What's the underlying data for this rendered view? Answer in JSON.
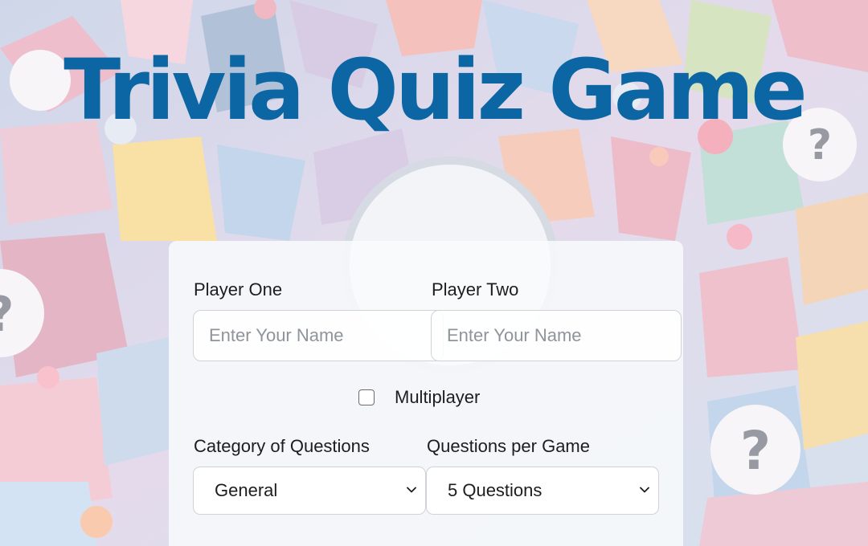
{
  "page": {
    "title": "Trivia Quiz Game"
  },
  "form": {
    "player_one": {
      "label": "Player One",
      "placeholder": "Enter Your Name",
      "value": ""
    },
    "player_two": {
      "label": "Player Two",
      "placeholder": "Enter Your Name",
      "value": ""
    },
    "multiplayer": {
      "label": "Multiplayer",
      "checked": false
    },
    "category": {
      "label": "Category of Questions",
      "selected": "General"
    },
    "questions_per_game": {
      "label": "Questions per Game",
      "selected": "5 Questions"
    }
  },
  "icons": {
    "background_motif": "question-mark-icon",
    "select_arrow": "chevron-down-icon"
  },
  "colors": {
    "title": "#0b66a3",
    "card_background": "#f8fafc",
    "text": "#1d1d1f",
    "placeholder": "#8f949a",
    "input_border": "#cfd3d8"
  }
}
